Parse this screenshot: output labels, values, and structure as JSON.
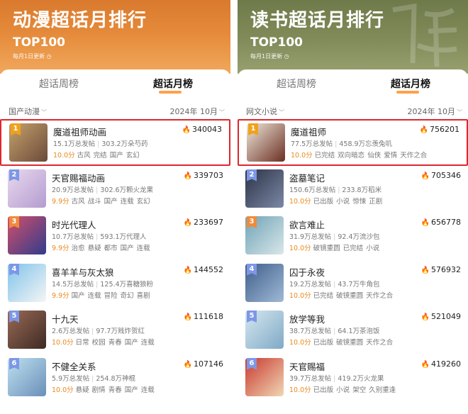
{
  "left": {
    "title": "动漫超话月排行",
    "subtitle": "TOP100",
    "update_note": "每月1日更新",
    "tabs": [
      "超话周榜",
      "超话月榜"
    ],
    "category": "国产动漫",
    "date": "2024年 10月",
    "items": [
      {
        "rank": "1",
        "name": "魔道祖师动画",
        "heat": "340043",
        "posts": "15.1万总发帖",
        "fans": "303.2万朵芍药",
        "score": "10.0分",
        "tags": [
          "古风",
          "完结",
          "国产",
          "玄幻"
        ],
        "thumb_colors": [
          "#c5a26b",
          "#6b4a3a"
        ]
      },
      {
        "rank": "2",
        "name": "天官赐福动画",
        "heat": "339703",
        "posts": "20.9万总发帖",
        "fans": "302.6万颗火龙果",
        "score": "9.9分",
        "tags": [
          "古风",
          "战斗",
          "国产",
          "连载",
          "玄幻"
        ],
        "thumb_colors": [
          "#e9d9ef",
          "#b39ccf"
        ]
      },
      {
        "rank": "3",
        "name": "时光代理人",
        "heat": "233697",
        "posts": "10.7万总发帖",
        "fans": "593.1万代理人",
        "score": "9.9分",
        "tags": [
          "治愈",
          "悬疑",
          "都市",
          "国产",
          "连载"
        ],
        "thumb_colors": [
          "#d34f6a",
          "#2f3c8c"
        ]
      },
      {
        "rank": "4",
        "name": "喜羊羊与灰太狼",
        "heat": "144552",
        "posts": "14.5万总发帖",
        "fans": "125.4万喜糖狼粉",
        "score": "9.9分",
        "tags": [
          "国产",
          "连载",
          "冒险",
          "奇幻",
          "喜剧"
        ],
        "thumb_colors": [
          "#7fc3ea",
          "#f5f5f5"
        ]
      },
      {
        "rank": "5",
        "name": "十九天",
        "heat": "111618",
        "posts": "2.6万总发帖",
        "fans": "97.7万贱炸贺红",
        "score": "10.0分",
        "tags": [
          "日常",
          "校园",
          "青春",
          "国产",
          "连载"
        ],
        "thumb_colors": [
          "#9a6a55",
          "#3d2a24"
        ]
      },
      {
        "rank": "6",
        "name": "不健全关系",
        "heat": "107146",
        "posts": "5.9万总发帖",
        "fans": "254.8万神棍",
        "score": "10.0分",
        "tags": [
          "悬疑",
          "剧情",
          "青春",
          "国产",
          "连载"
        ],
        "thumb_colors": [
          "#bfe0f0",
          "#6a8fb8"
        ]
      }
    ]
  },
  "right": {
    "title": "读书超话月排行",
    "subtitle": "TOP100",
    "update_note": "每月1日更新",
    "tabs": [
      "超话周榜",
      "超话月榜"
    ],
    "category": "网文小说",
    "date": "2024年 10月",
    "items": [
      {
        "rank": "1",
        "name": "魔道祖师",
        "heat": "756201",
        "posts": "77.5万总发帖",
        "fans": "458.9万忘羡兔叽",
        "score": "10.0分",
        "tags": [
          "已完结",
          "双向暗恋",
          "仙侠",
          "爱情",
          "天作之合"
        ],
        "thumb_colors": [
          "#efe9dc",
          "#6b2f22"
        ]
      },
      {
        "rank": "2",
        "name": "盗墓笔记",
        "heat": "705346",
        "posts": "150.6万总发帖",
        "fans": "233.8万稻米",
        "score": "10.0分",
        "tags": [
          "已出版",
          "小说",
          "惊悚",
          "正剧"
        ],
        "thumb_colors": [
          "#2c3346",
          "#7b88a6"
        ]
      },
      {
        "rank": "3",
        "name": "欲言难止",
        "heat": "656778",
        "posts": "31.9万总发帖",
        "fans": "92.4万流沙包",
        "score": "10.0分",
        "tags": [
          "破镜重圆",
          "已完结",
          "小说"
        ],
        "thumb_colors": [
          "#6fa3b7",
          "#d9e7e9"
        ]
      },
      {
        "rank": "4",
        "name": "囚于永夜",
        "heat": "576932",
        "posts": "19.2万总发帖",
        "fans": "43.7万牛角包",
        "score": "10.0分",
        "tags": [
          "已完结",
          "破镜重圆",
          "天作之合"
        ],
        "thumb_colors": [
          "#3f5e8a",
          "#9fb9d6"
        ]
      },
      {
        "rank": "5",
        "name": "放学等我",
        "heat": "521049",
        "posts": "38.7万总发帖",
        "fans": "64.1万茶泡饭",
        "score": "10.0分",
        "tags": [
          "已出版",
          "破镜重圆",
          "天作之合"
        ],
        "thumb_colors": [
          "#d6e8f0",
          "#7fa9c6"
        ]
      },
      {
        "rank": "6",
        "name": "天官赐福",
        "heat": "419260",
        "posts": "39.7万总发帖",
        "fans": "419.2万火龙果",
        "score": "10.0分",
        "tags": [
          "已出版",
          "小说",
          "架空",
          "久别重逢"
        ],
        "thumb_colors": [
          "#c9392f",
          "#f0d7b5"
        ]
      }
    ]
  },
  "colors": {
    "anime_header": "#e08236",
    "book_header": "#7b8653",
    "score": "#e98a1e",
    "flame": "#ef3b32",
    "highlight_border": "#e0262d",
    "tab_underline": "#ff8a1e"
  },
  "icons": {
    "clock": "clock-icon",
    "chevron": "chevron-down-icon",
    "flame": "flame-icon"
  }
}
